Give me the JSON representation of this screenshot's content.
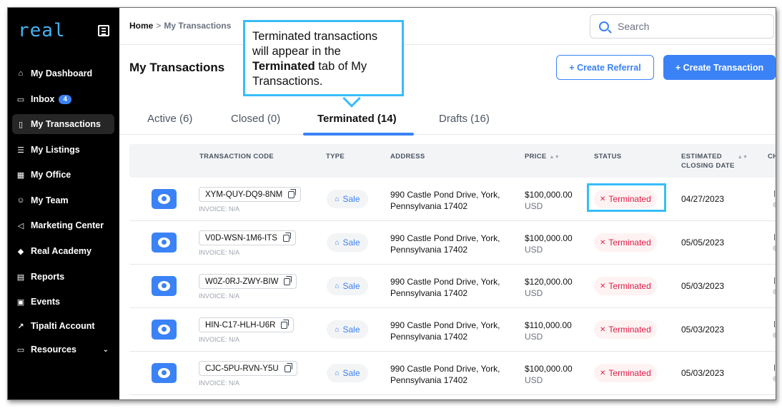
{
  "sidebar": {
    "logo": "real",
    "items": [
      {
        "label": "My Dashboard",
        "icon": "⌂"
      },
      {
        "label": "Inbox",
        "icon": "▭",
        "badge": "4"
      },
      {
        "label": "My Transactions",
        "icon": "▯"
      },
      {
        "label": "My Listings",
        "icon": "☰"
      },
      {
        "label": "My Office",
        "icon": "▦"
      },
      {
        "label": "My Team",
        "icon": "☺"
      },
      {
        "label": "Marketing Center",
        "icon": "◁"
      },
      {
        "label": "Real Academy",
        "icon": "◆"
      },
      {
        "label": "Reports",
        "icon": "▤"
      },
      {
        "label": "Events",
        "icon": "▣"
      },
      {
        "label": "Tipalti Account",
        "icon": "↗"
      },
      {
        "label": "Resources",
        "icon": "▭",
        "chevron": "⌄"
      }
    ]
  },
  "header": {
    "breadcrumb_home": "Home",
    "breadcrumb_sep": ">",
    "breadcrumb_current": "My Transactions",
    "search_placeholder": "Search"
  },
  "main": {
    "title": "My Transactions",
    "create_referral": "+ Create Referral",
    "create_transaction": "+ Create Transaction",
    "tabs": [
      {
        "label": "Active (6)"
      },
      {
        "label": "Closed (0)"
      },
      {
        "label": "Terminated (14)"
      },
      {
        "label": "Drafts (16)"
      }
    ],
    "columns": {
      "code": "TRANSACTION CODE",
      "type": "TYPE",
      "address": "ADDRESS",
      "price": "PRICE",
      "status": "STATUS",
      "closing_1": "ESTIMATED",
      "closing_2": "CLOSING DATE",
      "cut": "CH"
    },
    "rows": [
      {
        "code": "XYM-QUY-DQ9-8NM",
        "invoice": "INVOICE: N/A",
        "type": "Sale",
        "addr1": "990 Castle Pond Drive, York,",
        "addr2": "Pennsylvania 17402",
        "price": "$100,000.00",
        "currency": "USD",
        "status": "Terminated",
        "date": "04/27/2023"
      },
      {
        "code": "V0D-WSN-1M6-ITS",
        "invoice": "INVOICE: N/A",
        "type": "Sale",
        "addr1": "990 Castle Pond Drive, York,",
        "addr2": "Pennsylvania 17402",
        "price": "$100,000.00",
        "currency": "USD",
        "status": "Terminated",
        "date": "05/05/2023"
      },
      {
        "code": "W0Z-0RJ-ZWY-BIW",
        "invoice": "INVOICE: N/A",
        "type": "Sale",
        "addr1": "990 Castle Pond Drive, York,",
        "addr2": "Pennsylvania 17402",
        "price": "$120,000.00",
        "currency": "USD",
        "status": "Terminated",
        "date": "05/03/2023"
      },
      {
        "code": "HIN-C17-HLH-U6R",
        "invoice": "INVOICE: N/A",
        "type": "Sale",
        "addr1": "990 Castle Pond Drive, York,",
        "addr2": "Pennsylvania 17402",
        "price": "$110,000.00",
        "currency": "USD",
        "status": "Terminated",
        "date": "05/03/2023"
      },
      {
        "code": "CJC-5PU-RVN-Y5U",
        "invoice": "INVOICE: N/A",
        "type": "Sale",
        "addr1": "990 Castle Pond Drive, York,",
        "addr2": "Pennsylvania 17402",
        "price": "$100,000.00",
        "currency": "USD",
        "status": "Terminated",
        "date": "05/03/2023"
      }
    ]
  },
  "callout": {
    "line1": "Terminated transactions will appear in the ",
    "bold": "Terminated",
    "line2": " tab of My Transactions."
  },
  "colors": {
    "accent": "#3b82f6",
    "highlight": "#38bdf8",
    "terminated": "#e11d48"
  }
}
